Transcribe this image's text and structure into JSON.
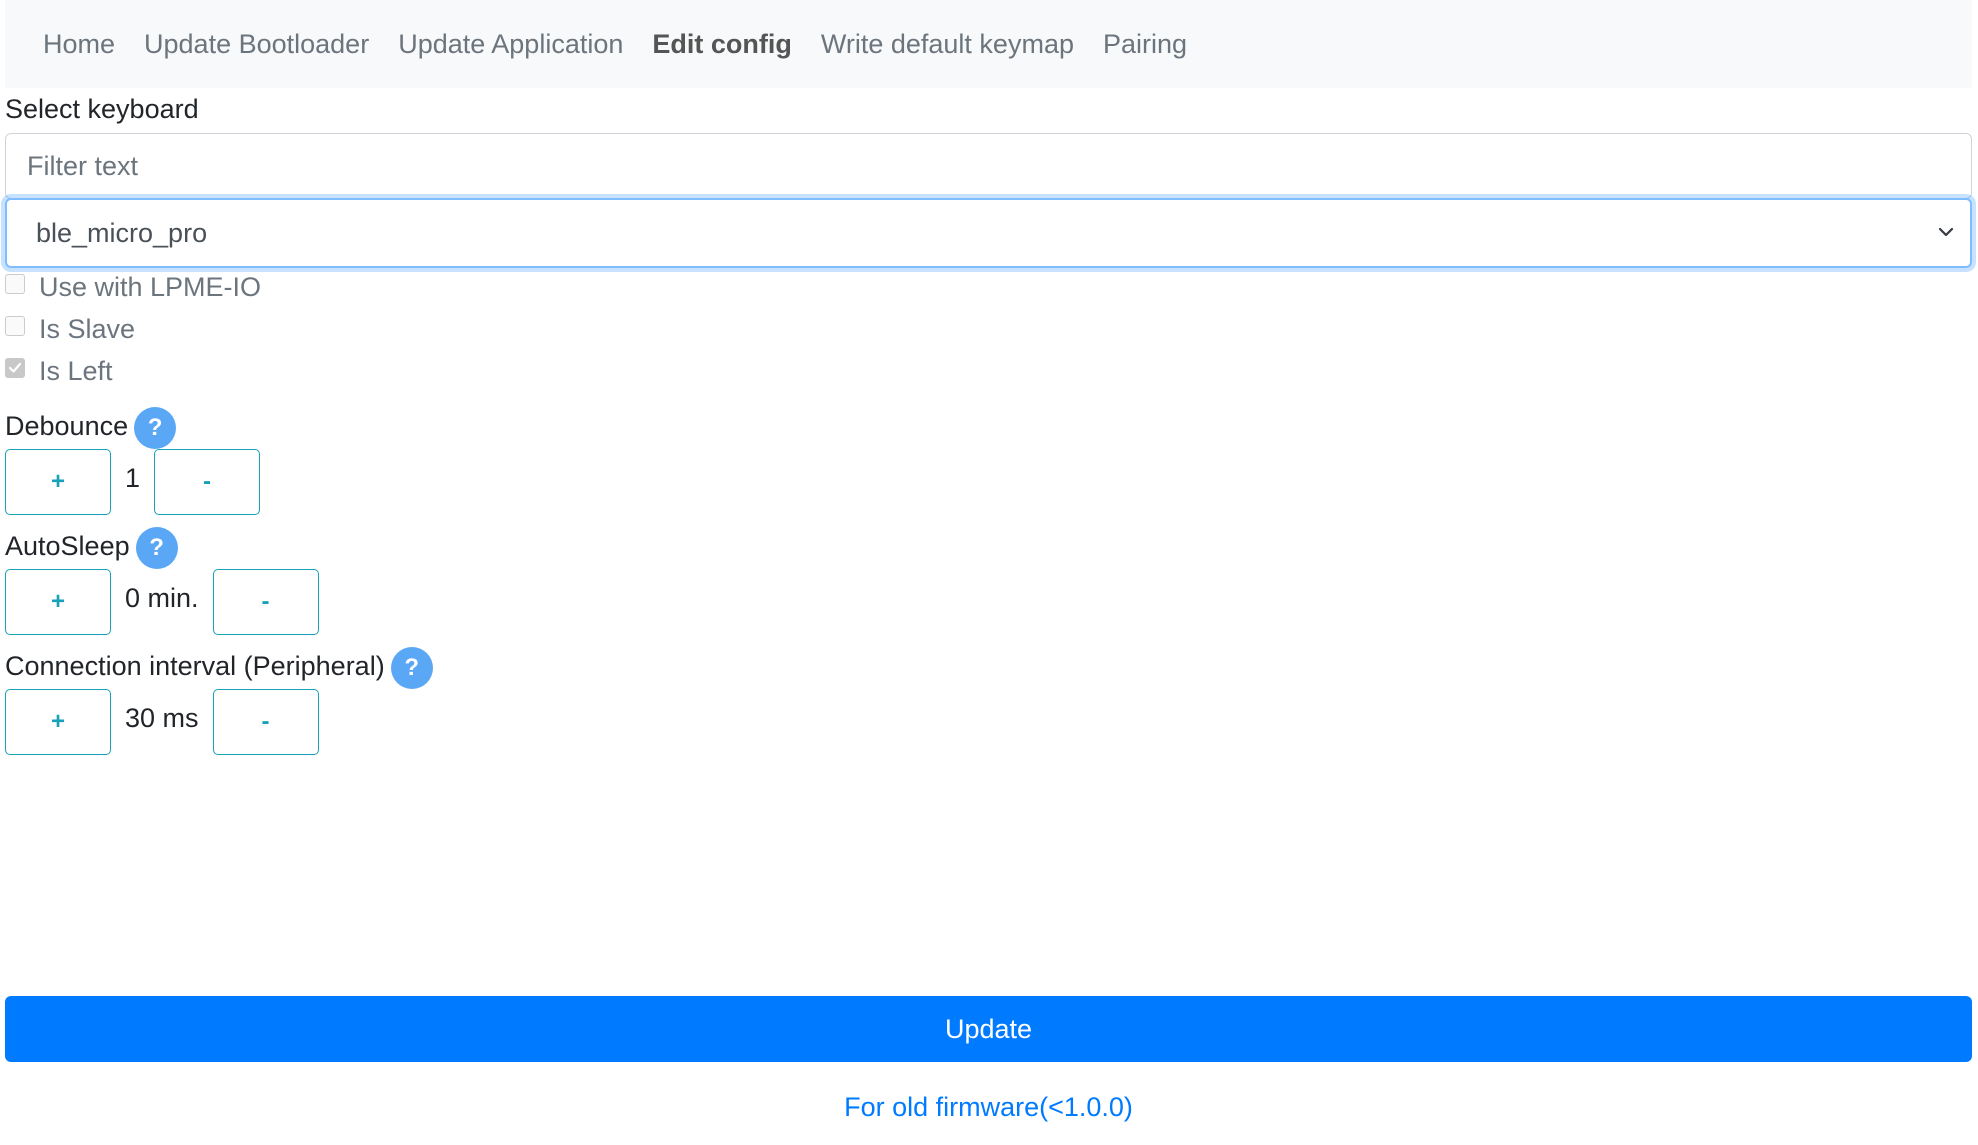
{
  "nav": {
    "items": [
      {
        "label": "Home",
        "active": false
      },
      {
        "label": "Update Bootloader",
        "active": false
      },
      {
        "label": "Update Application",
        "active": false
      },
      {
        "label": "Edit config",
        "active": true
      },
      {
        "label": "Write default keymap",
        "active": false
      },
      {
        "label": "Pairing",
        "active": false
      }
    ]
  },
  "keyboard": {
    "label": "Select keyboard",
    "filter_placeholder": "Filter text",
    "filter_value": "",
    "selected": "ble_micro_pro"
  },
  "options": {
    "use_lpme_io": {
      "label": "Use with LPME-IO",
      "checked": false
    },
    "is_slave": {
      "label": "Is Slave",
      "checked": false
    },
    "is_left": {
      "label": "Is Left",
      "checked": true
    }
  },
  "debounce": {
    "label": "Debounce",
    "help": "?",
    "plus": "+",
    "minus": "-",
    "value": "1"
  },
  "autosleep": {
    "label": "AutoSleep",
    "help": "?",
    "plus": "+",
    "minus": "-",
    "value": "0 min."
  },
  "conn_interval": {
    "label": "Connection interval (Peripheral)",
    "help": "?",
    "plus": "+",
    "minus": "-",
    "value": "30 ms"
  },
  "actions": {
    "update_label": "Update",
    "old_firmware_link": "For old firmware(<1.0.0)"
  },
  "colors": {
    "primary": "#007bff",
    "info": "#17a2b8",
    "help_icon": "#5aa7f5",
    "navbar_bg": "#f8f9fa"
  },
  "icons": {
    "select_arrow": "chevron-down-icon",
    "help": "question-circle-icon",
    "check": "check-icon"
  }
}
